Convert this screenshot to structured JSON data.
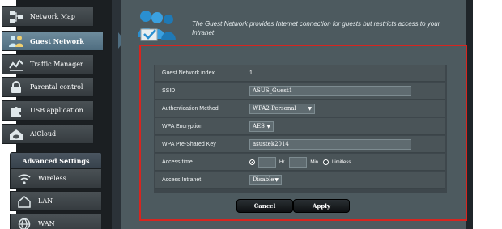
{
  "sidebar": {
    "items": [
      {
        "label": "Network Map",
        "icon": "network-map-icon"
      },
      {
        "label": "Guest Network",
        "icon": "guest-network-icon",
        "active": true
      },
      {
        "label": "Traffic Manager",
        "icon": "traffic-manager-icon"
      },
      {
        "label": "Parental control",
        "icon": "lock-icon"
      },
      {
        "label": "USB application",
        "icon": "puzzle-icon"
      },
      {
        "label": "AiCloud",
        "icon": "cloud-house-icon"
      }
    ],
    "advanced_heading": "Advanced Settings",
    "advanced_items": [
      {
        "label": "Wireless",
        "icon": "wifi-icon"
      },
      {
        "label": "LAN",
        "icon": "house-icon"
      },
      {
        "label": "WAN",
        "icon": "globe-icon"
      }
    ]
  },
  "header": {
    "description": "The Guest Network provides Internet connection for guests but restricts access to your Intranet"
  },
  "form": {
    "guest_index": {
      "label": "Guest Network index",
      "value": "1"
    },
    "ssid": {
      "label": "SSID",
      "value": "ASUS_Guest1"
    },
    "auth_method": {
      "label": "Authentication Method",
      "value": "WPA2-Personal"
    },
    "wpa_encryption": {
      "label": "WPA Encryption",
      "value": "AES"
    },
    "psk": {
      "label": "WPA Pre-Shared Key",
      "value": "asustek2014"
    },
    "access_time": {
      "label": "Access time",
      "hr_unit": "Hr",
      "min_unit": "Min",
      "limitless_label": "Limitless",
      "hr_value": "",
      "min_value": ""
    },
    "access_intranet": {
      "label": "Access Intranet",
      "value": "Disable"
    }
  },
  "buttons": {
    "cancel": "Cancel",
    "apply": "Apply"
  },
  "colors": {
    "highlight_border": "#d7251f",
    "active_nav": "#5f7d90",
    "panel_bg": "#4d5a5f"
  }
}
